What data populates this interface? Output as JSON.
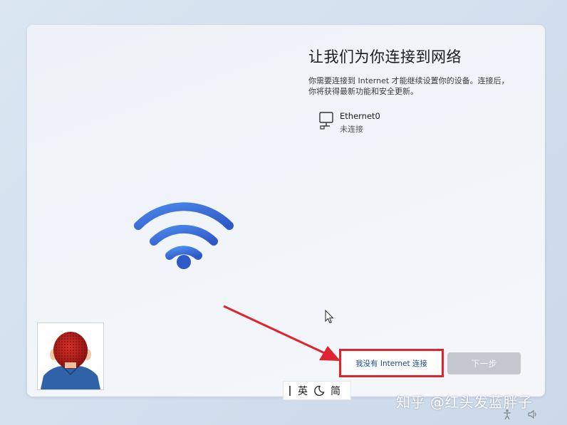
{
  "page": {
    "title": "让我们为你连接到网络",
    "description": "你需要连接到 Internet 才能继续设置你的设备。连接后，你将获得最新功能和安全更新。"
  },
  "networks": [
    {
      "icon": "ethernet-icon",
      "name": "Ethernet0",
      "status": "未连接"
    }
  ],
  "buttons": {
    "no_internet": "我没有 Internet 连接",
    "next": "下一步"
  },
  "ime": {
    "language": "英",
    "mode": "简"
  },
  "watermark": "知乎 @红头发蓝胖子",
  "colors": {
    "wifi_blue": "#3d6fd8",
    "highlight_red": "#e0242f",
    "next_disabled": "#c4c8ce"
  },
  "icons": {
    "illustration": "wifi-icon",
    "cursor": "mouse-pointer-icon",
    "annotation": "red-arrow-icon"
  }
}
